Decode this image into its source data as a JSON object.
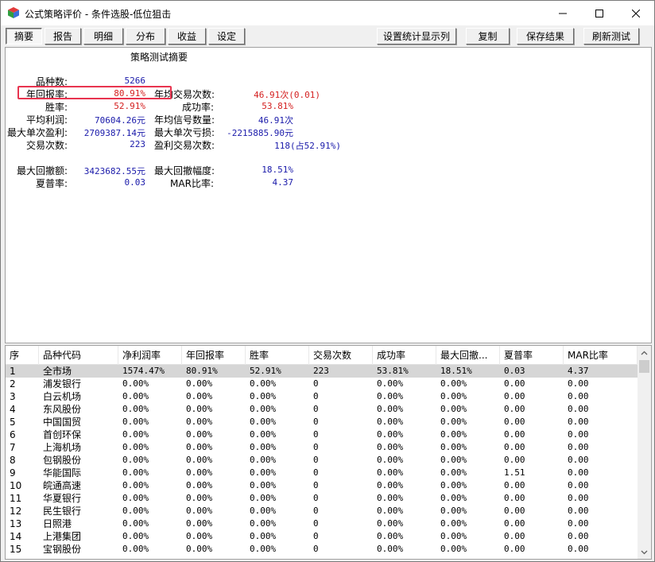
{
  "window": {
    "title": "公式策略评价 - 条件选股-低位狙击"
  },
  "toolbar": {
    "tabs": [
      "摘要",
      "报告",
      "明细",
      "分布",
      "收益",
      "设定"
    ],
    "actions": [
      "设置统计显示列",
      "复制",
      "保存结果",
      "刷新测试"
    ]
  },
  "summary": {
    "title": "策略测试摘要",
    "left": [
      {
        "label": "品种数:",
        "value": "5266",
        "color": "blue"
      },
      {
        "label": "年回报率:",
        "value": "80.91%",
        "color": "red"
      },
      {
        "label": "胜率:",
        "value": "52.91%",
        "color": "red"
      },
      {
        "label": "平均利润:",
        "value": "70604.26元",
        "color": "blue"
      },
      {
        "label": "最大单次盈利:",
        "value": "2709387.14元",
        "color": "blue"
      },
      {
        "label": "交易次数:",
        "value": "223",
        "color": "blue"
      },
      {
        "label": "最大回撤额:",
        "value": "3423682.55元",
        "color": "blue"
      },
      {
        "label": "夏普率:",
        "value": "0.03",
        "color": "blue"
      }
    ],
    "right": [
      {
        "label": "年均交易次数:",
        "value": "46.91次(0.01)",
        "color": "red"
      },
      {
        "label": "成功率:",
        "value": "53.81%",
        "color": "red"
      },
      {
        "label": "年均信号数量:",
        "value": "46.91次",
        "color": "blue"
      },
      {
        "label": "最大单次亏损:",
        "value": "-2215885.90元",
        "color": "blue"
      },
      {
        "label": "盈利交易次数:",
        "value": "118(占52.91%)",
        "color": "blue"
      },
      {
        "label": "最大回撤幅度:",
        "value": "18.51%",
        "color": "blue"
      },
      {
        "label": "MAR比率:",
        "value": "4.37",
        "color": "blue"
      }
    ]
  },
  "table": {
    "columns": [
      "序",
      "品种代码",
      "净利润率",
      "年回报率",
      "胜率",
      "交易次数",
      "成功率",
      "最大回撤...",
      "夏普率",
      "MAR比率"
    ],
    "rows": [
      [
        "1",
        "全市场",
        "1574.47%",
        "80.91%",
        "52.91%",
        "223",
        "53.81%",
        "18.51%",
        "0.03",
        "4.37"
      ],
      [
        "2",
        "浦发银行",
        "0.00%",
        "0.00%",
        "0.00%",
        "0",
        "0.00%",
        "0.00%",
        "0.00",
        "0.00"
      ],
      [
        "3",
        "白云机场",
        "0.00%",
        "0.00%",
        "0.00%",
        "0",
        "0.00%",
        "0.00%",
        "0.00",
        "0.00"
      ],
      [
        "4",
        "东风股份",
        "0.00%",
        "0.00%",
        "0.00%",
        "0",
        "0.00%",
        "0.00%",
        "0.00",
        "0.00"
      ],
      [
        "5",
        "中国国贸",
        "0.00%",
        "0.00%",
        "0.00%",
        "0",
        "0.00%",
        "0.00%",
        "0.00",
        "0.00"
      ],
      [
        "6",
        "首创环保",
        "0.00%",
        "0.00%",
        "0.00%",
        "0",
        "0.00%",
        "0.00%",
        "0.00",
        "0.00"
      ],
      [
        "7",
        "上海机场",
        "0.00%",
        "0.00%",
        "0.00%",
        "0",
        "0.00%",
        "0.00%",
        "0.00",
        "0.00"
      ],
      [
        "8",
        "包钢股份",
        "0.00%",
        "0.00%",
        "0.00%",
        "0",
        "0.00%",
        "0.00%",
        "0.00",
        "0.00"
      ],
      [
        "9",
        "华能国际",
        "0.00%",
        "0.00%",
        "0.00%",
        "0",
        "0.00%",
        "0.00%",
        "1.51",
        "0.00"
      ],
      [
        "10",
        "皖通高速",
        "0.00%",
        "0.00%",
        "0.00%",
        "0",
        "0.00%",
        "0.00%",
        "0.00",
        "0.00"
      ],
      [
        "11",
        "华夏银行",
        "0.00%",
        "0.00%",
        "0.00%",
        "0",
        "0.00%",
        "0.00%",
        "0.00",
        "0.00"
      ],
      [
        "12",
        "民生银行",
        "0.00%",
        "0.00%",
        "0.00%",
        "0",
        "0.00%",
        "0.00%",
        "0.00",
        "0.00"
      ],
      [
        "13",
        "日照港",
        "0.00%",
        "0.00%",
        "0.00%",
        "0",
        "0.00%",
        "0.00%",
        "0.00",
        "0.00"
      ],
      [
        "14",
        "上港集团",
        "0.00%",
        "0.00%",
        "0.00%",
        "0",
        "0.00%",
        "0.00%",
        "0.00",
        "0.00"
      ],
      [
        "15",
        "宝钢股份",
        "0.00%",
        "0.00%",
        "0.00%",
        "0",
        "0.00%",
        "0.00%",
        "0.00",
        "0.00"
      ]
    ]
  },
  "colors": {
    "highlight_border": "#e8344f",
    "value_blue": "#1a1aaa",
    "value_red": "#d42020",
    "selected_row": "#d6d6d6"
  },
  "icons": {
    "app": "colored-cube-icon",
    "minimize": "minimize-icon",
    "maximize": "maximize-icon",
    "close": "close-icon",
    "scroll_up": "chevron-up-icon",
    "scroll_down": "chevron-down-icon"
  }
}
